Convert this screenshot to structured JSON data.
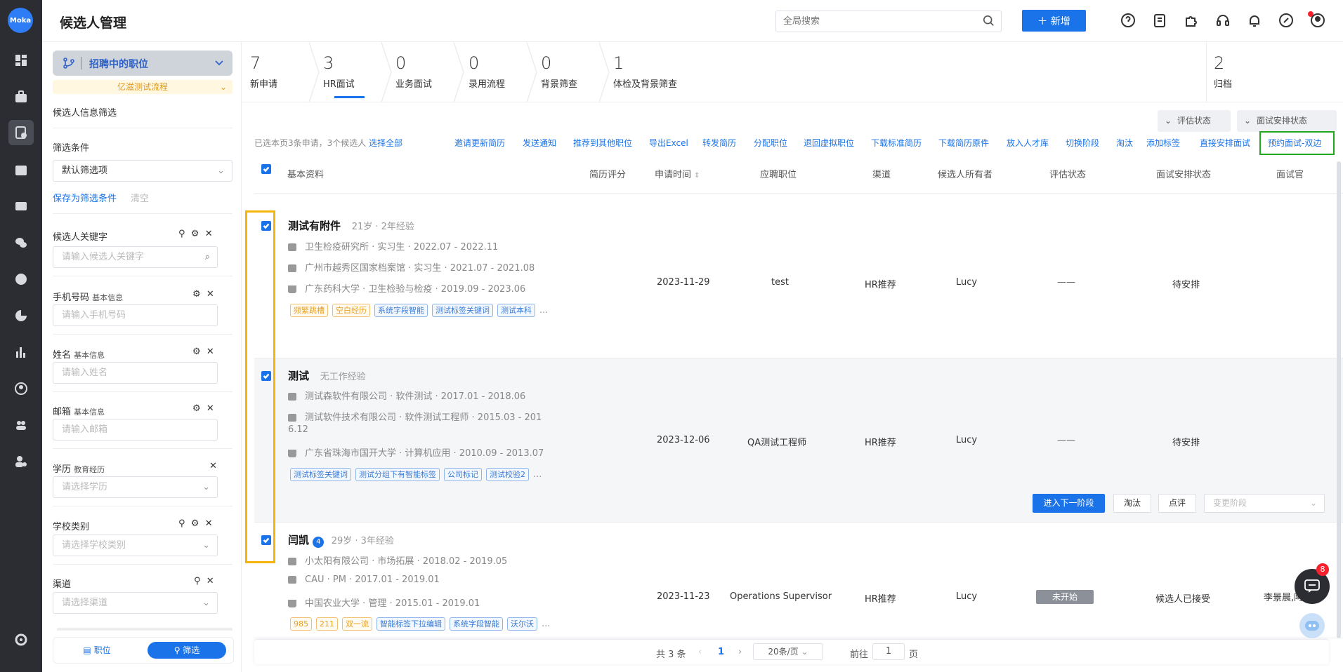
{
  "app": {
    "title": "候选人管理",
    "logo_text": "Moka"
  },
  "header": {
    "search_placeholder": "全局搜索",
    "new_button": "＋ 新增",
    "icons": [
      "help-icon",
      "document-icon",
      "puzzle-icon",
      "headset-icon",
      "bell-icon",
      "link-icon",
      "user-icon"
    ]
  },
  "sidebar": {
    "job_selector": "招聘中的职位",
    "flow_selector": "亿滋测试流程",
    "info_filter": "候选人信息筛选",
    "filter_label": "筛选条件",
    "filter_value": "默认筛选项",
    "save_filter": "保存为筛选条件",
    "clear": "清空",
    "fields": [
      {
        "label": "候选人关键字",
        "sub": "",
        "placeholder": "请输入候选人关键字"
      },
      {
        "label": "手机号码",
        "sub": "基本信息",
        "placeholder": "请输入手机号码"
      },
      {
        "label": "姓名",
        "sub": "基本信息",
        "placeholder": "请输入姓名"
      },
      {
        "label": "邮箱",
        "sub": "基本信息",
        "placeholder": "请输入邮箱"
      },
      {
        "label": "学历",
        "sub": "教育经历",
        "placeholder": "请选择学历"
      },
      {
        "label": "学校类别",
        "sub": "",
        "placeholder": "请选择学校类别"
      },
      {
        "label": "渠道",
        "sub": "",
        "placeholder": "请选择渠道"
      }
    ],
    "tab_position": "职位",
    "tab_filter": "筛选"
  },
  "stages": [
    {
      "count": "7",
      "label": "新申请"
    },
    {
      "count": "3",
      "label": "HR面试"
    },
    {
      "count": "0",
      "label": "业务面试"
    },
    {
      "count": "0",
      "label": "录用流程"
    },
    {
      "count": "0",
      "label": "背景筛查"
    },
    {
      "count": "1",
      "label": "体检及背景筛查"
    }
  ],
  "archive": {
    "count": "2",
    "label": "归档"
  },
  "filters": {
    "eval_status": "评估状态",
    "interview_status": "面试安排状态"
  },
  "selection": {
    "info": "已选本页3条申请，3个候选人",
    "select_all": "选择全部"
  },
  "actions": [
    "邀请更新简历",
    "发送通知",
    "推荐到其他职位",
    "导出Excel",
    "转发简历",
    "分配职位",
    "退回虚拟职位",
    "下载标准简历",
    "下载简历原件",
    "放入人才库",
    "切换阶段",
    "淘汰",
    "添加标签",
    "直接安排面试",
    "预约面试-双边"
  ],
  "columns": [
    "基本资料",
    "简历评分",
    "申请时间",
    "应聘职位",
    "渠道",
    "候选人所有者",
    "评估状态",
    "面试安排状态",
    "面试官"
  ],
  "candidates": [
    {
      "name": "测试有附件",
      "meta": "21岁 · 2年经验",
      "lines": [
        "卫生检疫研究所 · 实习生 · 2022.07 - 2022.11",
        "广州市越秀区国家档案馆 · 实习生 · 2021.07 - 2021.08",
        "广东药科大学 · 卫生检验与检疫 · 2019.09 - 2023.06"
      ],
      "tags": [
        {
          "t": "频繁跳槽",
          "c": "o"
        },
        {
          "t": "空白经历",
          "c": "o"
        },
        {
          "t": "系统字段智能",
          "c": "b"
        },
        {
          "t": "测试标签关键词",
          "c": "b"
        },
        {
          "t": "测试本科",
          "c": "b"
        }
      ],
      "more": "...",
      "date": "2023-11-29",
      "position": "test",
      "channel": "HR推荐",
      "owner": "Lucy",
      "eval": "——",
      "interview": "待安排",
      "interviewer": ""
    },
    {
      "name": "测试",
      "meta": "无工作经验",
      "lines": [
        "测试森软件有限公司 · 软件测试 · 2017.01 - 2018.06",
        "测试软件技术有限公司 · 软件测试工程师 · 2015.03 - 201",
        "6.12",
        "广东省珠海市国开大学 · 计算机应用 · 2010.09 - 2013.07"
      ],
      "tags": [
        {
          "t": "测试标签关键词",
          "c": "b"
        },
        {
          "t": "测试分组下有智能标签",
          "c": "b"
        },
        {
          "t": "公司标记",
          "c": "b"
        },
        {
          "t": "测试校验2",
          "c": "b"
        }
      ],
      "more": "...",
      "date": "2023-12-06",
      "position": "QA测试工程师",
      "channel": "HR推荐",
      "owner": "Lucy",
      "eval": "——",
      "interview": "待安排",
      "interviewer": "",
      "buttons": {
        "next": "进入下一阶段",
        "reject": "淘汰",
        "comment": "点评",
        "change": "变更阶段"
      }
    },
    {
      "name": "闫凯",
      "badge": "4",
      "meta": "29岁 · 3年经验",
      "lines": [
        "小太阳有限公司 · 市场拓展 · 2018.02 - 2019.05",
        "CAU · PM · 2017.01 - 2019.01",
        "中国农业大学 · 管理 · 2015.01 - 2019.01"
      ],
      "tags": [
        {
          "t": "985",
          "c": "o"
        },
        {
          "t": "211",
          "c": "o"
        },
        {
          "t": "双一流",
          "c": "o"
        },
        {
          "t": "智能标签下拉编辑",
          "c": "b"
        },
        {
          "t": "系统字段智能",
          "c": "b"
        },
        {
          "t": "沃尔沃",
          "c": "b"
        }
      ],
      "more": "...",
      "date": "2023-11-23",
      "position": "Operations Supervisor",
      "channel": "HR推荐",
      "owner": "Lucy",
      "eval": "未开始",
      "interview": "候选人已接受",
      "interviewer": "李景晨,阿"
    }
  ],
  "pager": {
    "total": "共 3 条",
    "page": "1",
    "per_page": "20条/页",
    "goto": "前往",
    "goto_value": "1",
    "page_unit": "页"
  },
  "chat_badge": "8"
}
